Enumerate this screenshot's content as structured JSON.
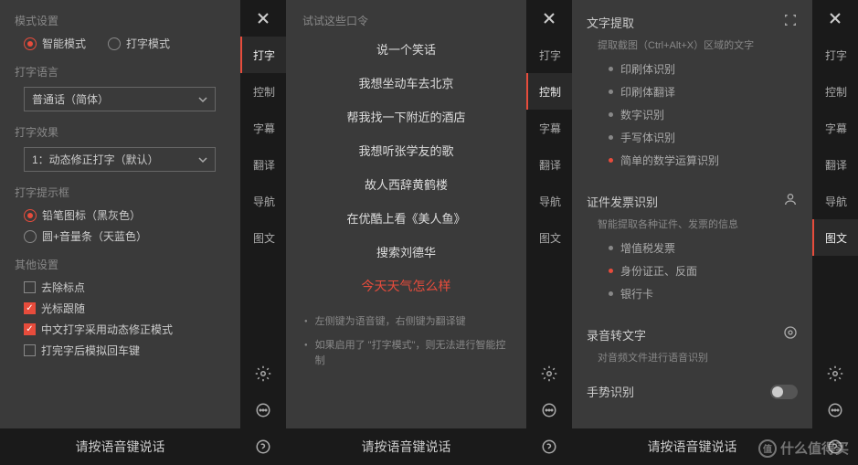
{
  "sidebar": {
    "items": [
      {
        "label": "打字"
      },
      {
        "label": "控制"
      },
      {
        "label": "字幕"
      },
      {
        "label": "翻译"
      },
      {
        "label": "导航"
      },
      {
        "label": "图文"
      }
    ]
  },
  "panel1": {
    "mode_section": "模式设置",
    "mode_smart": "智能模式",
    "mode_type": "打字模式",
    "lang_section": "打字语言",
    "lang_value": "普通话（简体）",
    "effect_section": "打字效果",
    "effect_value": "1：动态修正打字（默认）",
    "hint_section": "打字提示框",
    "hint_pencil": "铅笔图标（黑灰色）",
    "hint_circle": "圆+音量条（天蓝色）",
    "other_section": "其他设置",
    "check_remove": "去除标点",
    "check_cursor": "光标跟随",
    "check_dynamic": "中文打字采用动态修正模式",
    "check_enter": "打完字后模拟回车键",
    "footer": "请按语音键说话"
  },
  "panel2": {
    "title": "试试这些口令",
    "cmds": [
      "说一个笑话",
      "我想坐动车去北京",
      "帮我找一下附近的酒店",
      "我想听张学友的歌",
      "故人西辞黄鹤楼",
      "在优酷上看《美人鱼》",
      "搜索刘德华",
      "今天天气怎么样"
    ],
    "hints": [
      "左侧键为语音键，右侧键为翻译键",
      "如果启用了 \"打字模式\"，则无法进行智能控制"
    ],
    "footer": "请按语音键说话"
  },
  "panel3": {
    "text_extract": {
      "title": "文字提取",
      "sub": "提取截图（Ctrl+Alt+X）区域的文字",
      "items": [
        {
          "label": "印刷体识别",
          "hot": false
        },
        {
          "label": "印刷体翻译",
          "hot": false
        },
        {
          "label": "数字识别",
          "hot": false
        },
        {
          "label": "手写体识别",
          "hot": false
        },
        {
          "label": "简单的数学运算识别",
          "hot": true
        }
      ]
    },
    "doc_recog": {
      "title": "证件发票识别",
      "sub": "智能提取各种证件、发票的信息",
      "items": [
        {
          "label": "增值税发票",
          "hot": false
        },
        {
          "label": "身份证正、反面",
          "hot": true
        },
        {
          "label": "银行卡",
          "hot": false
        }
      ]
    },
    "audio": {
      "title": "录音转文字",
      "sub": "对音频文件进行语音识别"
    },
    "gesture": "手势识别",
    "footer": "请按语音键说话"
  },
  "watermark": "什么值得买"
}
